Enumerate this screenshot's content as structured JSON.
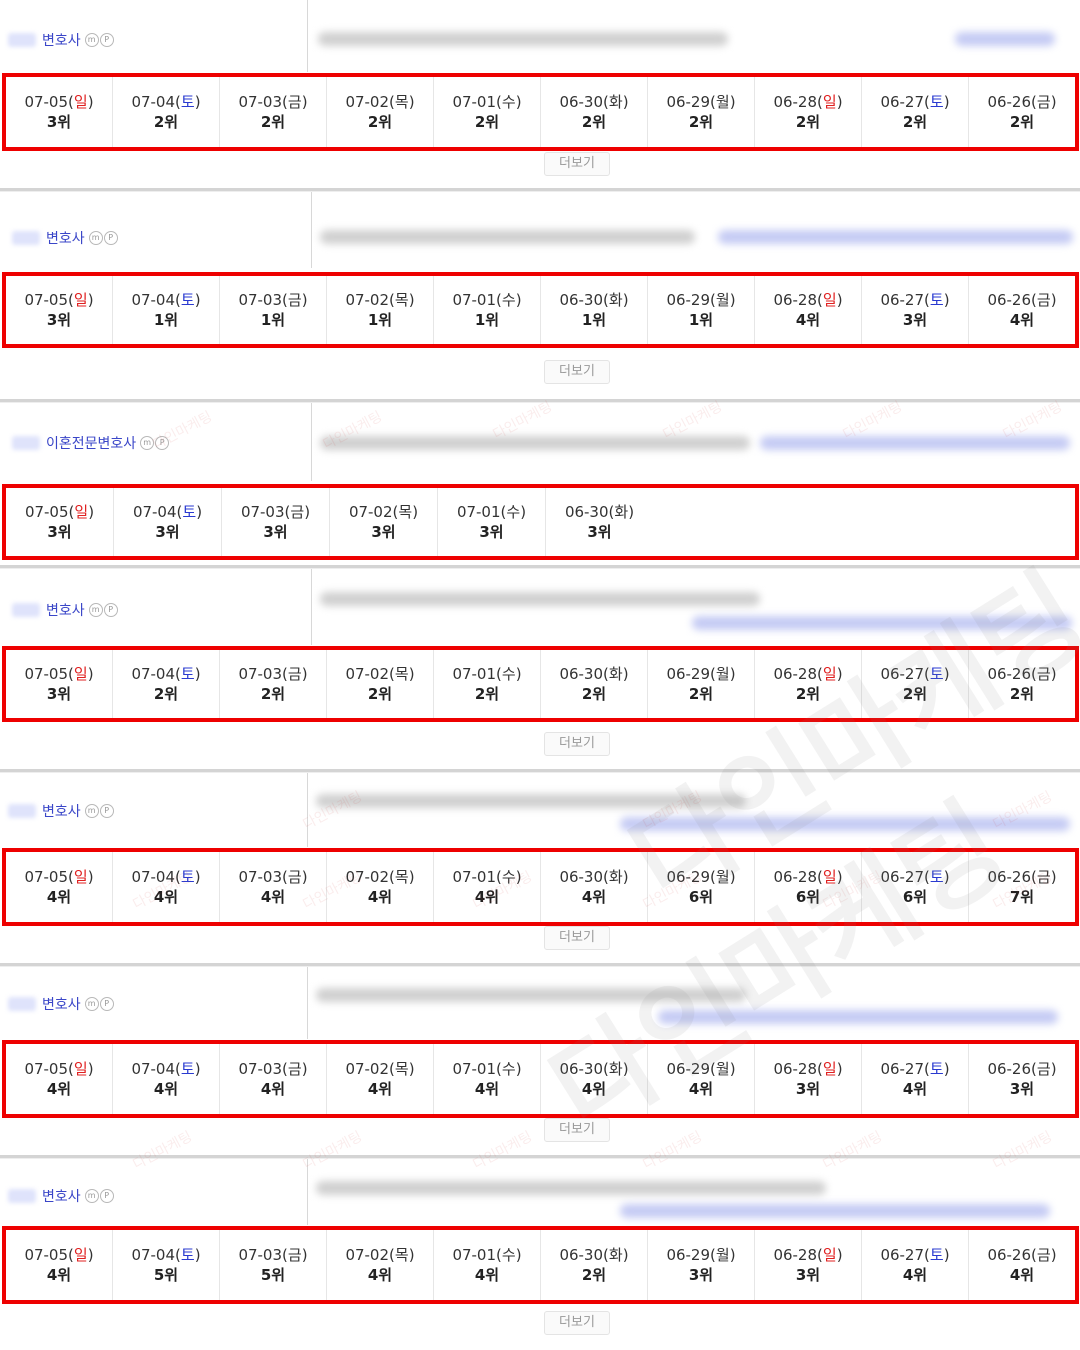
{
  "more_label": "더보기",
  "icons": {
    "mobile": "m",
    "pc": "P"
  },
  "watermark": "다인마케팅",
  "colors": {
    "highlight": "#ee0000",
    "sunday": "#e02020",
    "saturday": "#2a3ad0",
    "name": "#3a46c8"
  },
  "listings": [
    {
      "name": "변호사",
      "entries": [
        {
          "date": "07-05",
          "day": "일",
          "rank": "3위"
        },
        {
          "date": "07-04",
          "day": "토",
          "rank": "2위"
        },
        {
          "date": "07-03",
          "day": "금",
          "rank": "2위"
        },
        {
          "date": "07-02",
          "day": "목",
          "rank": "2위"
        },
        {
          "date": "07-01",
          "day": "수",
          "rank": "2위"
        },
        {
          "date": "06-30",
          "day": "화",
          "rank": "2위"
        },
        {
          "date": "06-29",
          "day": "월",
          "rank": "2위"
        },
        {
          "date": "06-28",
          "day": "일",
          "rank": "2위"
        },
        {
          "date": "06-27",
          "day": "토",
          "rank": "2위"
        },
        {
          "date": "06-26",
          "day": "금",
          "rank": "2위"
        }
      ]
    },
    {
      "name": "변호사",
      "entries": [
        {
          "date": "07-05",
          "day": "일",
          "rank": "3위"
        },
        {
          "date": "07-04",
          "day": "토",
          "rank": "1위"
        },
        {
          "date": "07-03",
          "day": "금",
          "rank": "1위"
        },
        {
          "date": "07-02",
          "day": "목",
          "rank": "1위"
        },
        {
          "date": "07-01",
          "day": "수",
          "rank": "1위"
        },
        {
          "date": "06-30",
          "day": "화",
          "rank": "1위"
        },
        {
          "date": "06-29",
          "day": "월",
          "rank": "1위"
        },
        {
          "date": "06-28",
          "day": "일",
          "rank": "4위"
        },
        {
          "date": "06-27",
          "day": "토",
          "rank": "3위"
        },
        {
          "date": "06-26",
          "day": "금",
          "rank": "4위"
        }
      ]
    },
    {
      "name": "이혼전문변호사",
      "entries": [
        {
          "date": "07-05",
          "day": "일",
          "rank": "3위"
        },
        {
          "date": "07-04",
          "day": "토",
          "rank": "3위"
        },
        {
          "date": "07-03",
          "day": "금",
          "rank": "3위"
        },
        {
          "date": "07-02",
          "day": "목",
          "rank": "3위"
        },
        {
          "date": "07-01",
          "day": "수",
          "rank": "3위"
        },
        {
          "date": "06-30",
          "day": "화",
          "rank": "3위"
        }
      ]
    },
    {
      "name": "변호사",
      "entries": [
        {
          "date": "07-05",
          "day": "일",
          "rank": "3위"
        },
        {
          "date": "07-04",
          "day": "토",
          "rank": "2위"
        },
        {
          "date": "07-03",
          "day": "금",
          "rank": "2위"
        },
        {
          "date": "07-02",
          "day": "목",
          "rank": "2위"
        },
        {
          "date": "07-01",
          "day": "수",
          "rank": "2위"
        },
        {
          "date": "06-30",
          "day": "화",
          "rank": "2위"
        },
        {
          "date": "06-29",
          "day": "월",
          "rank": "2위"
        },
        {
          "date": "06-28",
          "day": "일",
          "rank": "2위"
        },
        {
          "date": "06-27",
          "day": "토",
          "rank": "2위"
        },
        {
          "date": "06-26",
          "day": "금",
          "rank": "2위"
        }
      ]
    },
    {
      "name": "변호사",
      "entries": [
        {
          "date": "07-05",
          "day": "일",
          "rank": "4위"
        },
        {
          "date": "07-04",
          "day": "토",
          "rank": "4위"
        },
        {
          "date": "07-03",
          "day": "금",
          "rank": "4위"
        },
        {
          "date": "07-02",
          "day": "목",
          "rank": "4위"
        },
        {
          "date": "07-01",
          "day": "수",
          "rank": "4위"
        },
        {
          "date": "06-30",
          "day": "화",
          "rank": "4위"
        },
        {
          "date": "06-29",
          "day": "월",
          "rank": "6위"
        },
        {
          "date": "06-28",
          "day": "일",
          "rank": "6위"
        },
        {
          "date": "06-27",
          "day": "토",
          "rank": "6위"
        },
        {
          "date": "06-26",
          "day": "금",
          "rank": "7위"
        }
      ]
    },
    {
      "name": "변호사",
      "entries": [
        {
          "date": "07-05",
          "day": "일",
          "rank": "4위"
        },
        {
          "date": "07-04",
          "day": "토",
          "rank": "4위"
        },
        {
          "date": "07-03",
          "day": "금",
          "rank": "4위"
        },
        {
          "date": "07-02",
          "day": "목",
          "rank": "4위"
        },
        {
          "date": "07-01",
          "day": "수",
          "rank": "4위"
        },
        {
          "date": "06-30",
          "day": "화",
          "rank": "4위"
        },
        {
          "date": "06-29",
          "day": "월",
          "rank": "4위"
        },
        {
          "date": "06-28",
          "day": "일",
          "rank": "3위"
        },
        {
          "date": "06-27",
          "day": "토",
          "rank": "4위"
        },
        {
          "date": "06-26",
          "day": "금",
          "rank": "3위"
        }
      ]
    },
    {
      "name": "변호사",
      "entries": [
        {
          "date": "07-05",
          "day": "일",
          "rank": "4위"
        },
        {
          "date": "07-04",
          "day": "토",
          "rank": "5위"
        },
        {
          "date": "07-03",
          "day": "금",
          "rank": "5위"
        },
        {
          "date": "07-02",
          "day": "목",
          "rank": "4위"
        },
        {
          "date": "07-01",
          "day": "수",
          "rank": "4위"
        },
        {
          "date": "06-30",
          "day": "화",
          "rank": "2위"
        },
        {
          "date": "06-29",
          "day": "월",
          "rank": "3위"
        },
        {
          "date": "06-28",
          "day": "일",
          "rank": "3위"
        },
        {
          "date": "06-27",
          "day": "토",
          "rank": "4위"
        },
        {
          "date": "06-26",
          "day": "금",
          "rank": "4위"
        }
      ]
    }
  ]
}
